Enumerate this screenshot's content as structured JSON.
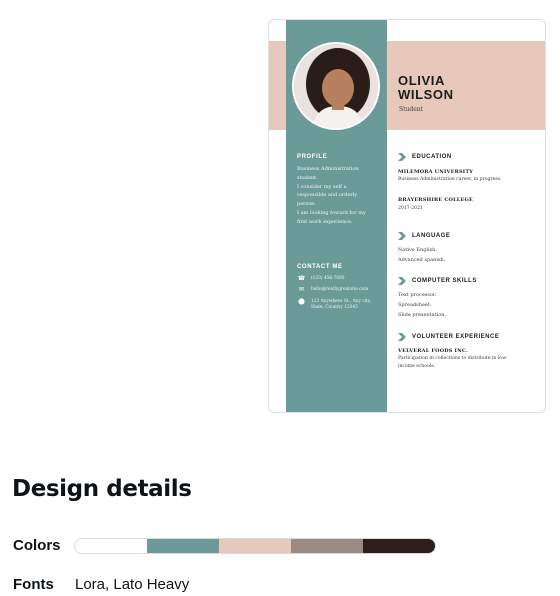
{
  "resume": {
    "first_name": "OLIVIA",
    "last_name": "WILSON",
    "role": "Student",
    "profile": {
      "heading": "PROFILE",
      "text": "Business Administration student.\nI consider my self a responsible and orderly person.\nI am looking foward for my first work experience."
    },
    "contact": {
      "heading": "CONTACT ME",
      "phone": "(123) 456-7890",
      "email": "hello@reallygreatsite.com",
      "address": "123 Anywhere St., Any city, State, Country 12345"
    },
    "education": {
      "heading": "EDUCATION",
      "school1": "MILEMORA UNIVERSITY",
      "school1_desc": "Business Administration career, in progress.",
      "school2": "BRAYERSHIRE COLLEGE",
      "school2_years": "2017-2021"
    },
    "language": {
      "heading": "LANGUAGE",
      "line1": "Native English.",
      "line2": "Advanced spanish."
    },
    "computer_skills": {
      "heading": "COMPUTER SKILLS",
      "line1": "Text processor.",
      "line2": "Spreadsheet.",
      "line3": "Slide presentation."
    },
    "volunteer": {
      "heading": "VOLUNTEER EXPERIENCE",
      "org": "VELVERAL FOODS INC.",
      "desc": "Participation in collections to distribute in low-income schools."
    }
  },
  "design_details": {
    "title": "Design details",
    "colors_label": "Colors",
    "colors": [
      "#ffffff",
      "#6b9b99",
      "#e6c9bb",
      "#9a8a84",
      "#2c1e1d"
    ],
    "fonts_label": "Fonts",
    "fonts_value": "Lora, Lato Heavy"
  },
  "icons": {
    "phone": "phone-icon",
    "email": "envelope-icon",
    "address": "location-pin-icon",
    "section_marker": "chevron-right-icon"
  }
}
